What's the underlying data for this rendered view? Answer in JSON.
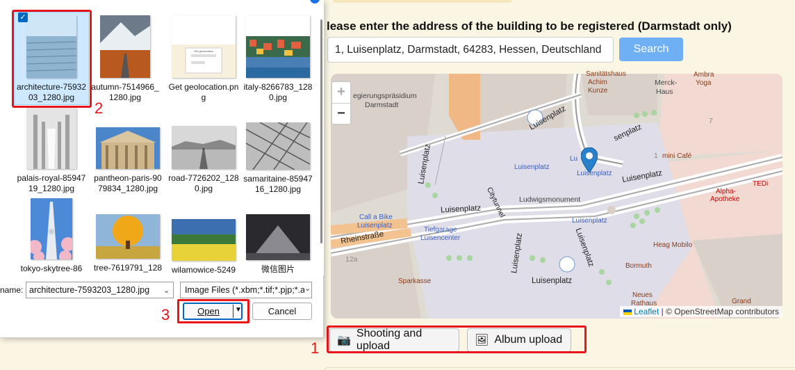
{
  "page": {
    "prompt": "lease enter the address of the building to be registered (Darmstadt only)",
    "address_value": "1, Luisenplatz, Darmstadt, 64283, Hessen, Deutschland",
    "search_label": "Search",
    "zoom_in": "+",
    "zoom_out": "−",
    "attribution_leaflet": "Leaflet",
    "attribution_osm": "| © OpenStreetMap contributors",
    "shoot_label": "Shooting and upload",
    "album_label": "Album upload",
    "shoot_icon": "camera-icon",
    "album_icon": "picture-icon"
  },
  "map_labels": {
    "regierung": "egierungspräsidium",
    "darmstadt": "Darmstadt",
    "sanitaets": "Sanitätshaus",
    "achim": "Achim",
    "kunze": "Kunze",
    "merck": "Merck-",
    "haus": "Haus",
    "ambra": "Ambra",
    "yoga": "Yoga",
    "luisenplatz_blue1": "Luisenplatz",
    "luisenplatz_blue2": "Luisenplatz",
    "luisenplatz_blue3": "Luisenplatz",
    "luisenplatz_blue4": "Luisenplatz",
    "lu_blue": "Lu",
    "ludwigs": "Ludwigsmonument",
    "calla1": "Call a Bike",
    "calla2": "Luisenplatz",
    "tiefgarage": "Tiefgarage",
    "luisencenter": "Luisencenter",
    "sparkasse": "Sparkasse",
    "mini_cafe": "mini Café",
    "tedi": "TEDi",
    "alpha": "Alpha-",
    "apotheke": "Apotheke",
    "heag": "Heag Mobilo",
    "bormuth": "Bormuth",
    "neues": "Neues",
    "rathaus": "Rathaus",
    "grand": "Grand",
    "rheinstrasse": "Rheinstraße",
    "num_12a": "12a",
    "num_7": "7",
    "num_1": "1",
    "street_luisenplatz_v1": "Luisenplatz",
    "street_luisenplatz_h": "Luisenplatz",
    "street_luisenplatz_v2": "Luisenplatz",
    "street_luisenplatz_v3": "Luisenplatz",
    "street_luisenplatz_b": "Luisenplatz",
    "street_luisenplatz_r": "Luisenplatz",
    "street_senplatz": "senplatz",
    "street_cityt": "Citytunnel"
  },
  "dialog": {
    "files": [
      {
        "name": "architecture-7593203_1280.jpg",
        "selected": true
      },
      {
        "name": "autumn-7514966_1280.jpg"
      },
      {
        "name": "Get geolocation.png"
      },
      {
        "name": "italy-8266783_1280.jpg"
      },
      {
        "name": "palais-royal-8594719_1280.jpg"
      },
      {
        "name": "pantheon-paris-9079834_1280.jpg"
      },
      {
        "name": "road-7726202_1280.jpg"
      },
      {
        "name": "samaritaine-8594716_1280.jpg"
      },
      {
        "name": "tokyo-skytree-86"
      },
      {
        "name": "tree-7619791_128"
      },
      {
        "name": "wilamowice-5249"
      },
      {
        "name": "微信图片"
      }
    ],
    "name_label": "name:",
    "name_value": "architecture-7593203_1280.jpg",
    "type_value": "Image Files (*.xbm;*.tif;*.pjp;*.a",
    "open_label": "Open",
    "cancel_label": "Cancel",
    "thumb_label": "Get geolocation"
  },
  "annotations": {
    "step1": "1",
    "step2": "2",
    "step3": "3"
  },
  "colors": {
    "highlight": "#e8141a",
    "search_button": "#6fb0f5",
    "selection": "#cde8ff",
    "page_bg": "#fbf6e4"
  }
}
